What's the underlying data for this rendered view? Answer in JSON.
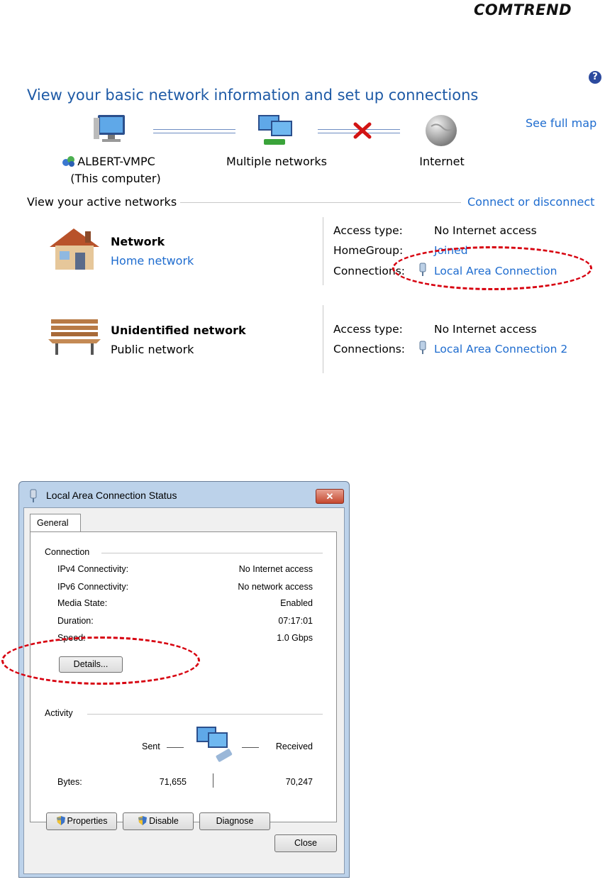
{
  "brand": "COMTREND",
  "network_center": {
    "title": "View your basic network information and set up connections",
    "see_full_map": "See full map",
    "map": {
      "computer_name": "ALBERT-VMPC",
      "computer_sub": "(This computer)",
      "middle": "Multiple networks",
      "internet": "Internet"
    },
    "active_networks_label": "View your active networks",
    "connect_link": "Connect or disconnect",
    "networks": [
      {
        "name": "Network",
        "type": "Home network",
        "access_label": "Access type:",
        "access_value": "No Internet access",
        "homegroup_label": "HomeGroup:",
        "homegroup_value": "Joined",
        "connections_label": "Connections:",
        "connection_value": "Local Area Connection"
      },
      {
        "name": "Unidentified network",
        "type": "Public network",
        "access_label": "Access type:",
        "access_value": "No Internet access",
        "connections_label": "Connections:",
        "connection_value": "Local Area Connection 2"
      }
    ]
  },
  "dialog": {
    "title": "Local Area Connection Status",
    "tab": "General",
    "connection_group": "Connection",
    "rows": [
      {
        "label": "IPv4 Connectivity:",
        "value": "No Internet access"
      },
      {
        "label": "IPv6 Connectivity:",
        "value": "No network access"
      },
      {
        "label": "Media State:",
        "value": "Enabled"
      },
      {
        "label": "Duration:",
        "value": "07:17:01"
      },
      {
        "label": "Speed:",
        "value": "1.0 Gbps"
      }
    ],
    "details_button": "Details...",
    "activity_group": "Activity",
    "sent_label": "Sent",
    "received_label": "Received",
    "bytes_label": "Bytes:",
    "bytes_sent": "71,655",
    "bytes_received": "70,247",
    "properties_button": "Properties",
    "disable_button": "Disable",
    "diagnose_button": "Diagnose",
    "close_button": "Close"
  },
  "colors": {
    "link": "#1e6ccf",
    "title": "#1e5aa6",
    "annotation": "#d7000f"
  }
}
